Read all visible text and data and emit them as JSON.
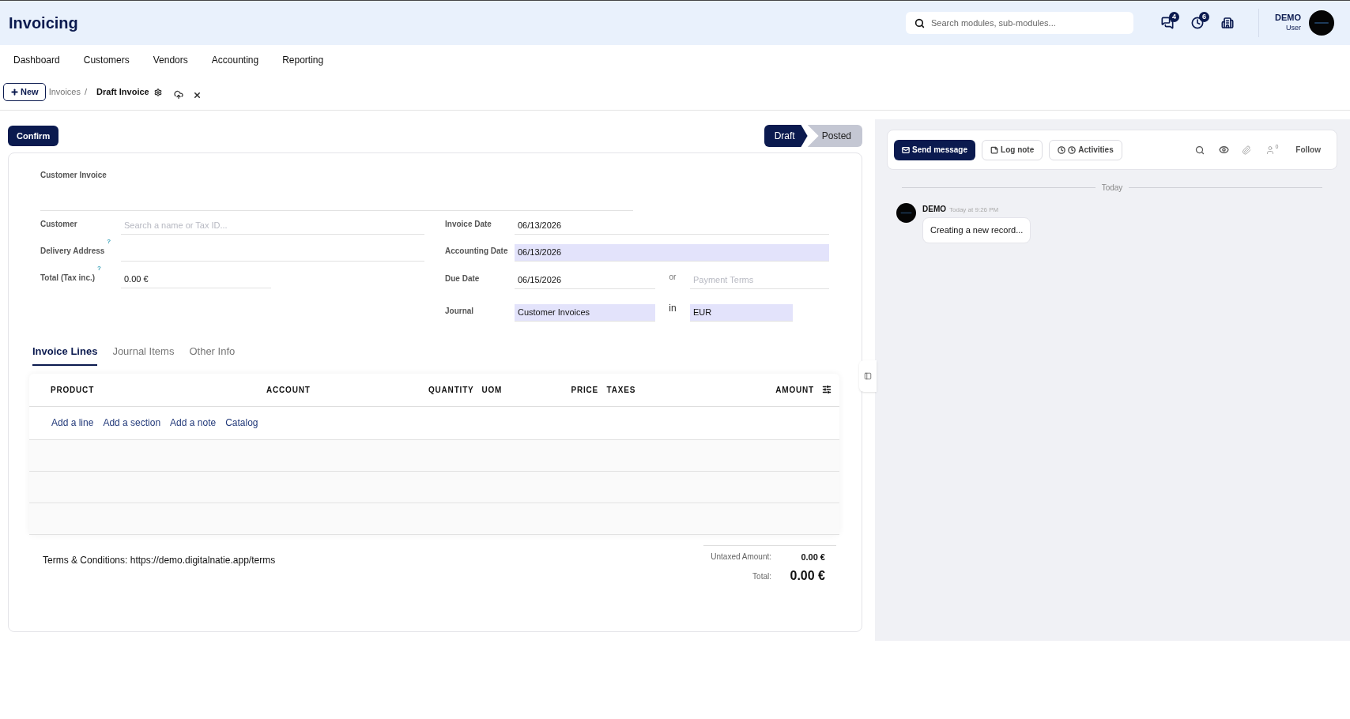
{
  "app": {
    "title": "Invoicing",
    "search_placeholder": "Search modules, sub-modules...",
    "notifications": [
      {
        "kind": "messages",
        "badge": "4"
      },
      {
        "kind": "activities",
        "badge": "6"
      },
      {
        "kind": "company"
      }
    ],
    "user": {
      "name": "DEMO",
      "role": "User"
    }
  },
  "nav": [
    "Dashboard",
    "Customers",
    "Vendors",
    "Accounting",
    "Reporting"
  ],
  "breadcrumb": {
    "new_button": "New",
    "parent": "Invoices",
    "separator": "/",
    "current": "Draft Invoice"
  },
  "confirm_button": "Confirm",
  "statusbar": [
    {
      "label": "Draft",
      "selected": true
    },
    {
      "label": "Posted",
      "selected": false
    }
  ],
  "form": {
    "type_label": "Customer Invoice",
    "left_fields": [
      {
        "label": "Customer",
        "placeholder": "Search a name or Tax ID...",
        "highlighted": false
      },
      {
        "label": "Delivery Address",
        "help_mark": "?",
        "highlighted": false
      },
      {
        "label": "Total (Tax inc.)",
        "value": "0.00 €",
        "help_mark": "?",
        "highlighted": false
      }
    ],
    "right_fields": [
      {
        "label": "Invoice Date",
        "value": "06/13/2026",
        "highlighted": false
      },
      {
        "label": "Accounting Date",
        "value": "06/13/2026",
        "highlighted": true
      },
      {
        "label": "Due Date",
        "value": "06/15/2026",
        "highlighted": false,
        "joiner": "or",
        "extra": {
          "placeholder": "Payment Terms",
          "highlighted": false
        }
      },
      {
        "label": "Journal",
        "value": "Customer Invoices",
        "highlighted": true,
        "joiner": "in",
        "extra": {
          "value": "EUR",
          "highlighted": true
        }
      }
    ]
  },
  "tabs": [
    {
      "label": "Invoice Lines",
      "selected": true
    },
    {
      "label": "Journal Items",
      "selected": false
    },
    {
      "label": "Other Info",
      "selected": false
    }
  ],
  "table": {
    "columns": [
      "PRODUCT",
      "ACCOUNT",
      "QUANTITY",
      "UOM",
      "PRICE",
      "TAXES",
      "AMOUNT"
    ],
    "add_links": [
      "Add a line",
      "Add a section",
      "Add a note",
      "Catalog"
    ]
  },
  "terms": "Terms & Conditions: https://demo.digitalnatie.app/terms",
  "totals": [
    {
      "label": "Untaxed Amount:",
      "value": "0.00 €",
      "kind": "sub"
    },
    {
      "label": "Total:",
      "value": "0.00 €",
      "kind": "grand"
    }
  ],
  "chatter": {
    "buttons": [
      {
        "label": "Send message",
        "kind": "primary"
      },
      {
        "label": "Log note",
        "kind": "secondary"
      },
      {
        "label": "Activities",
        "kind": "secondary"
      }
    ],
    "followers": "0",
    "follow": "Follow",
    "day": "Today",
    "messages": [
      {
        "author": "DEMO",
        "time": "Today at 9:26 PM",
        "body": "Creating a new record..."
      }
    ]
  }
}
